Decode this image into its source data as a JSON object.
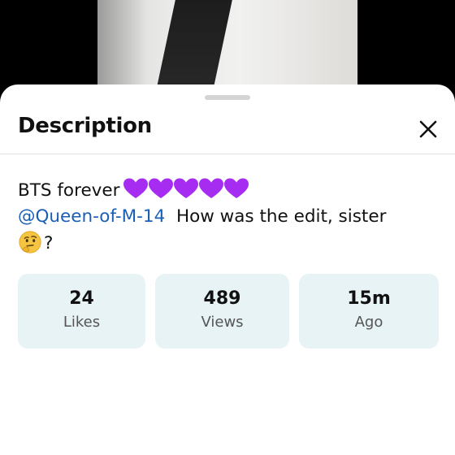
{
  "sheet": {
    "title": "Description",
    "close_icon": "close-icon"
  },
  "description": {
    "line1_text": "BTS forever",
    "heart_count": 5,
    "heart_icon": "purple-heart-icon",
    "heart_color": "#a52cf0",
    "mention": "@Queen-of-M-14",
    "mention_color": "#1a5fb4",
    "message": "How was the edit, sister",
    "thinking_icon": "thinking-face-icon",
    "trailing": "?"
  },
  "stats": [
    {
      "value": "24",
      "label": "Likes"
    },
    {
      "value": "489",
      "label": "Views"
    },
    {
      "value": "15m",
      "label": "Ago"
    }
  ],
  "colors": {
    "stat_card_bg": "#e8f3f6"
  }
}
